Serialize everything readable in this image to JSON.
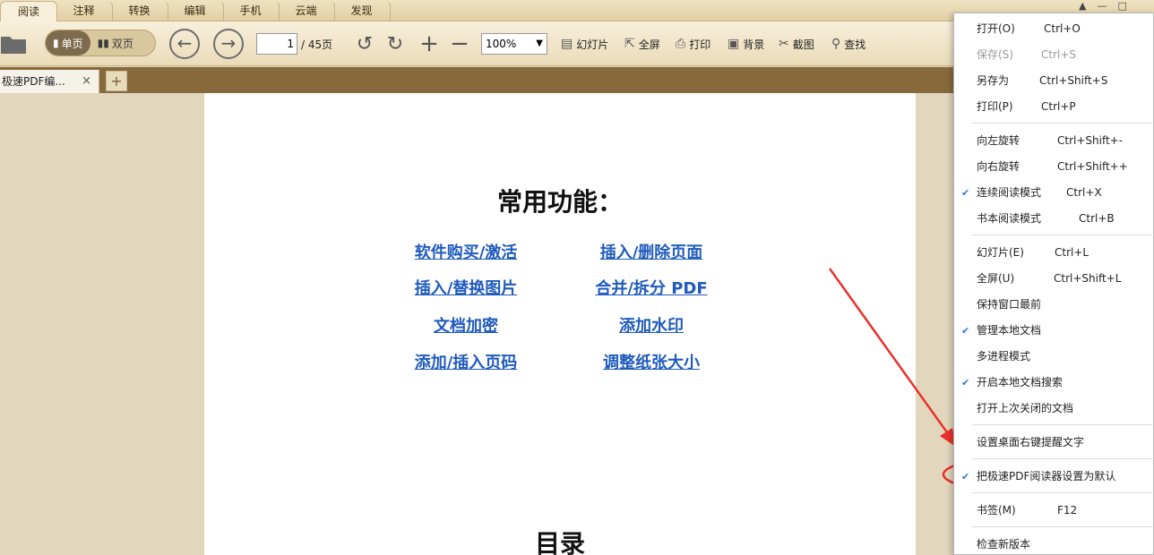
{
  "tabs": [
    "阅读",
    "注释",
    "转换",
    "编辑",
    "手机",
    "云端",
    "发现"
  ],
  "toolbar": {
    "single_label": "单页",
    "double_label": "双页",
    "page_value": "1",
    "page_total": "/ 45页",
    "zoom_value": "100%",
    "slideshow": "幻灯片",
    "fullscreen": "全屏",
    "print": "打印",
    "background": "背景",
    "screenshot": "截图",
    "find": "查找"
  },
  "doc_tab": {
    "title": "极速PDF编...",
    "close": "×",
    "new": "+"
  },
  "page": {
    "title": "常用功能：",
    "links": [
      "软件购买/激活",
      "插入/删除页面",
      "插入/替换图片",
      "合并/拆分 PDF",
      "文档加密",
      "添加水印",
      "添加/插入页码",
      "调整纸张大小"
    ],
    "toc_title": "目录"
  },
  "menu": {
    "items": [
      {
        "label": "打开(O)",
        "shortcut": "Ctrl+O"
      },
      {
        "label": "保存(S)",
        "shortcut": "Ctrl+S",
        "disabled": true
      },
      {
        "label": "另存为",
        "shortcut": "Ctrl+Shift+S"
      },
      {
        "label": "打印(P)",
        "shortcut": "Ctrl+P"
      },
      {
        "label": "向左旋转",
        "shortcut": "Ctrl+Shift+-"
      },
      {
        "label": "向右旋转",
        "shortcut": "Ctrl+Shift++"
      },
      {
        "label": "连续阅读模式",
        "shortcut": "Ctrl+X",
        "checked": true
      },
      {
        "label": "书本阅读模式",
        "shortcut": "Ctrl+B"
      },
      {
        "label": "幻灯片(E)",
        "shortcut": "Ctrl+L"
      },
      {
        "label": "全屏(U)",
        "shortcut": "Ctrl+Shift+L"
      },
      {
        "label": "保持窗口最前",
        "shortcut": ""
      },
      {
        "label": "管理本地文档",
        "shortcut": "",
        "checked": true
      },
      {
        "label": "多进程模式",
        "shortcut": ""
      },
      {
        "label": "开启本地文档搜索",
        "shortcut": "",
        "checked": true
      },
      {
        "label": "打开上次关闭的文档",
        "shortcut": ""
      },
      {
        "label": "设置桌面右键提醒文字",
        "shortcut": ""
      },
      {
        "label": "把极速PDF阅读器设置为默认",
        "shortcut": "",
        "checked": true
      },
      {
        "label": "书签(M)",
        "shortcut": "F12"
      },
      {
        "label": "检查新版本",
        "shortcut": ""
      }
    ]
  },
  "colors": {
    "accent_red": "#e8312a",
    "link_blue": "#1f5bbd",
    "check_blue": "#2b79d4"
  }
}
